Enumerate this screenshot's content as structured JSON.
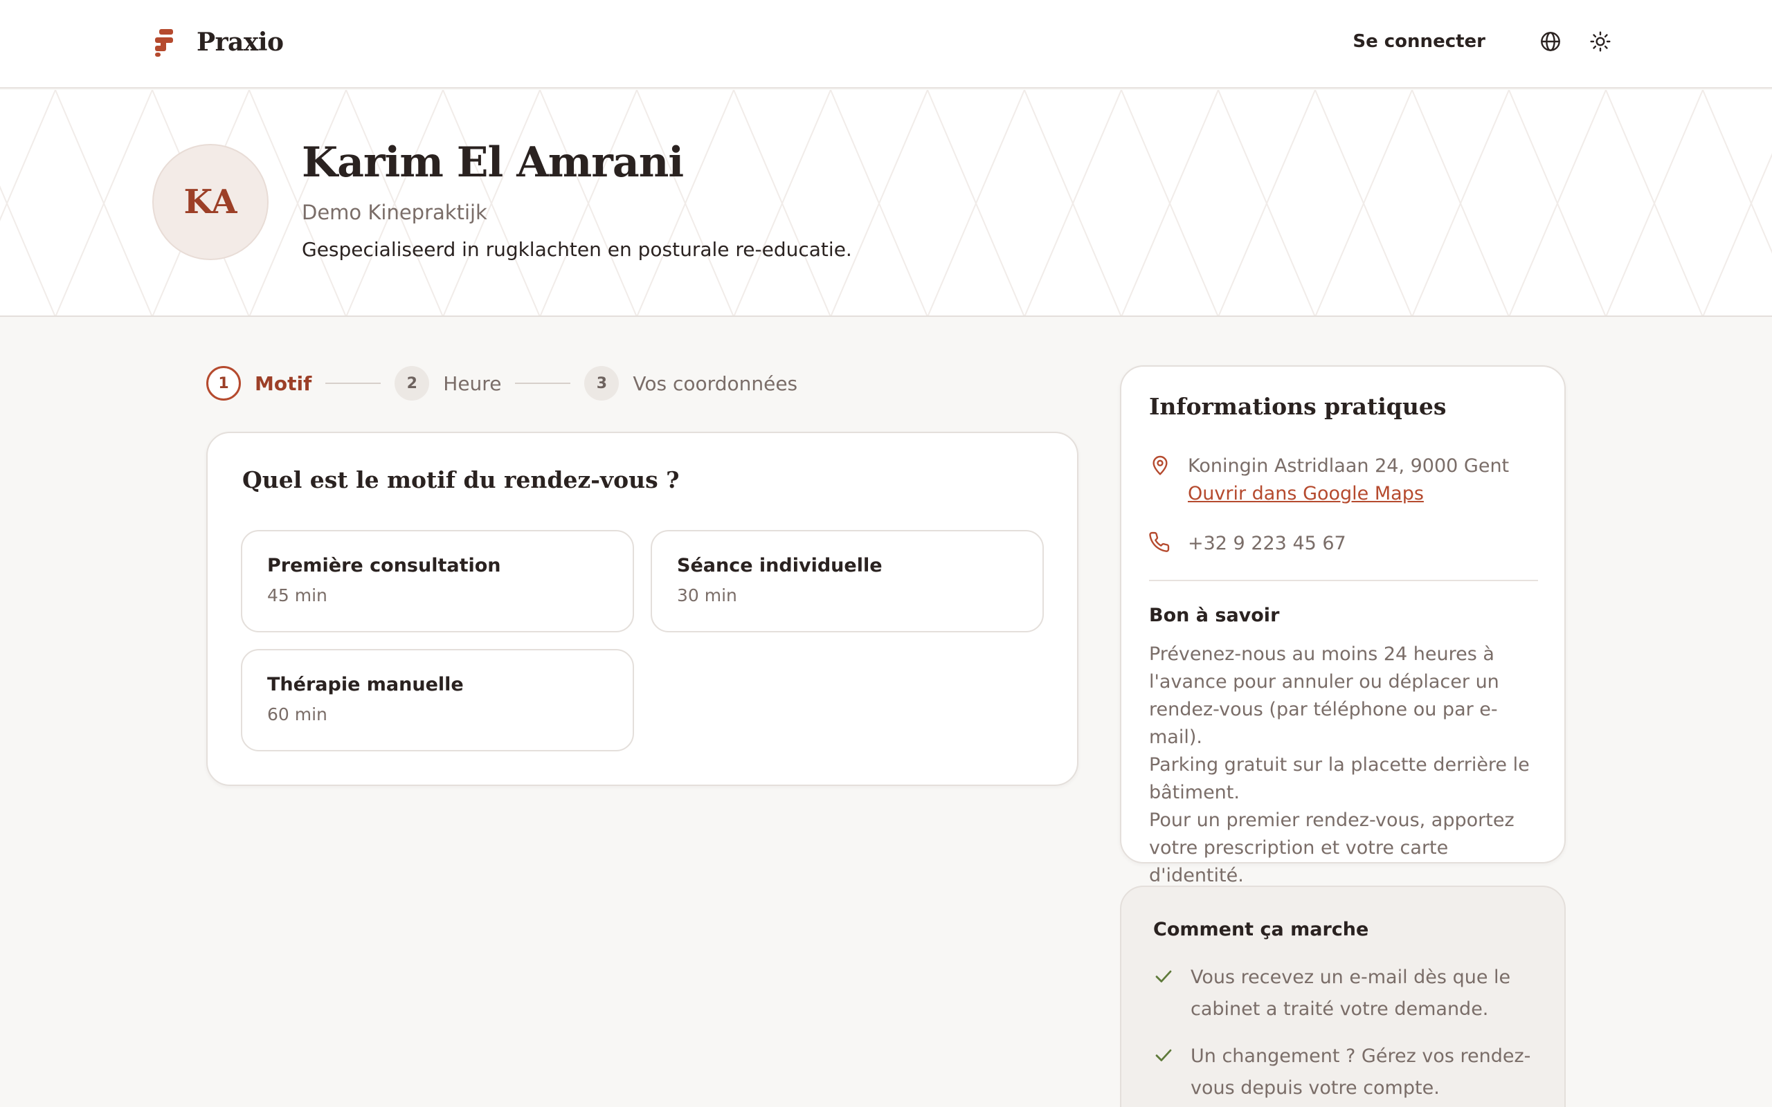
{
  "header": {
    "brand_name": "Praxio",
    "login_label": "Se connecter",
    "language_icon": "globe-icon",
    "theme_icon": "sun-icon",
    "accent_color": "#b54a2e"
  },
  "profile": {
    "initials": "KA",
    "name": "Karim El Amrani",
    "practice": "Demo Kinepraktijk",
    "description": "Gespecialiseerd in rugklachten en posturale re-educatie."
  },
  "stepper": {
    "steps": [
      {
        "number": "1",
        "label": "Motif",
        "state": "active"
      },
      {
        "number": "2",
        "label": "Heure",
        "state": "pending"
      },
      {
        "number": "3",
        "label": "Vos coordonnées",
        "state": "pending"
      }
    ]
  },
  "motif": {
    "title": "Quel est le motif du rendez-vous ?",
    "options": [
      {
        "name": "Première consultation",
        "duration": "45 min"
      },
      {
        "name": "Séance individuelle",
        "duration": "30 min"
      },
      {
        "name": "Thérapie manuelle",
        "duration": "60 min"
      }
    ]
  },
  "info": {
    "title": "Informations pratiques",
    "address": "Koningin Astridlaan 24, 9000 Gent",
    "maps_link": "Ouvrir dans Google Maps",
    "phone": "+32 9 223 45 67",
    "good_to_know_title": "Bon à savoir",
    "good_to_know_lines": [
      "Prévenez-nous au moins 24 heures à l'avance pour annuler ou déplacer un rendez-vous (par téléphone ou par e-mail).",
      "Parking gratuit sur la placette derrière le bâtiment.",
      "Pour un premier rendez-vous, apportez votre prescription et votre carte d'identité."
    ]
  },
  "how_it_works": {
    "title": "Comment ça marche",
    "items": [
      "Vous recevez un e-mail dès que le cabinet a traité votre demande.",
      "Un changement ? Gérez vos rendez-vous depuis votre compte."
    ]
  }
}
